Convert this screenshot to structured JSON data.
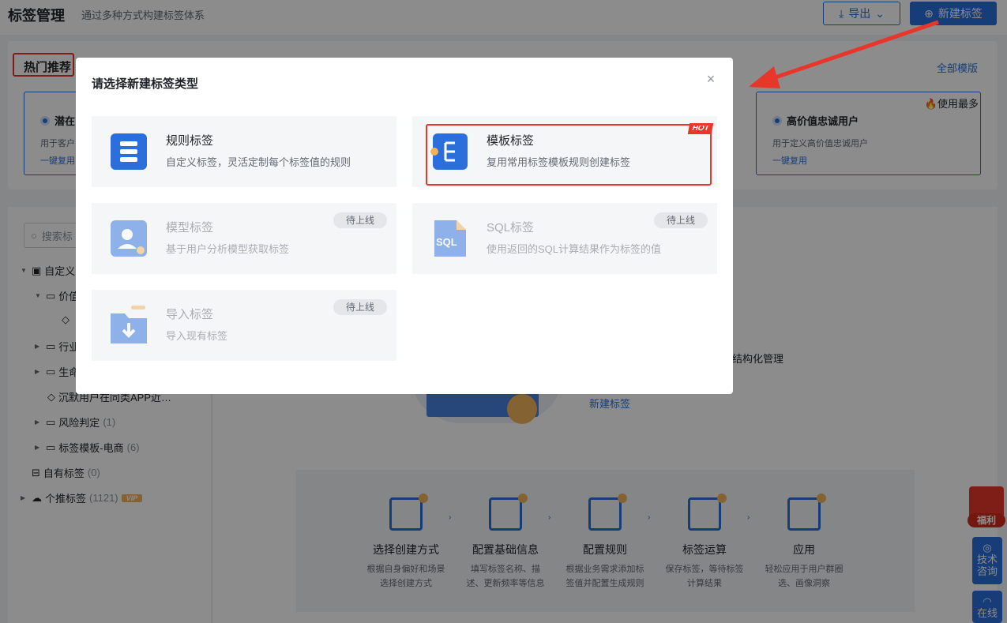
{
  "header": {
    "title": "标签管理",
    "subtitle": "通过多种方式构建标签体系",
    "export_label": "导出",
    "new_label": "新建标签"
  },
  "hot": {
    "title": "热门推荐",
    "all_templates": "全部模版",
    "cards": [
      {
        "name": "潜在",
        "desc": "用于客户",
        "copy": "一键复用"
      },
      {
        "name": "高价值忠诚用户",
        "desc": "用于定义高价值忠诚用户",
        "copy": "一键复用",
        "badge": "使用最多"
      }
    ]
  },
  "sidebar": {
    "search_placeholder": "搜索标",
    "items": [
      {
        "label": "自定义",
        "count": ""
      },
      {
        "label": "价值",
        "count": ""
      },
      {
        "label": "行业",
        "count": ""
      },
      {
        "label": "生命",
        "count": ""
      },
      {
        "label": "沉默用户在同类APP近…",
        "count": ""
      },
      {
        "label": "风险判定",
        "count": "(1)"
      },
      {
        "label": "标签模板-电商",
        "count": "(6)"
      },
      {
        "label": "自有标签",
        "count": "(0)"
      },
      {
        "label": "个推标签",
        "count": "(1121)",
        "badge": "VIP"
      }
    ]
  },
  "main": {
    "text": "行结构化管理",
    "link": "新建标签",
    "steps": [
      {
        "title": "选择创建方式",
        "desc1": "根据自身偏好和场景",
        "desc2": "选择创建方式"
      },
      {
        "title": "配置基础信息",
        "desc1": "填写标签名称、描",
        "desc2": "述、更新频率等信息"
      },
      {
        "title": "配置规则",
        "desc1": "根据业务需求添加标",
        "desc2": "签值并配置生成规则"
      },
      {
        "title": "标签运算",
        "desc1": "保存标签，等待标签",
        "desc2": "计算结果"
      },
      {
        "title": "应用",
        "desc1": "轻松应用于用户群圈",
        "desc2": "选、画像洞察"
      }
    ]
  },
  "floating": {
    "gift_label": "福利",
    "support_line1": "技术",
    "support_line2": "咨询",
    "online_label": "在线"
  },
  "modal": {
    "title": "请选择新建标签类型",
    "cards": [
      {
        "name": "规则标签",
        "desc": "自定义标签，灵活定制每个标签值的规则"
      },
      {
        "name": "模板标签",
        "desc": "复用常用标签模板规则创建标签",
        "tag": "HOT"
      },
      {
        "name": "模型标签",
        "desc": "基于用户分析模型获取标签",
        "status": "待上线"
      },
      {
        "name": "SQL标签",
        "desc": "使用返回的SQL计算结果作为标签的值",
        "status": "待上线"
      },
      {
        "name": "导入标签",
        "desc": "导入现有标签",
        "status": "待上线"
      }
    ]
  },
  "colors": {
    "primary": "#2a6fdb",
    "highlight": "#e8362b",
    "accent": "#f3b25a"
  }
}
